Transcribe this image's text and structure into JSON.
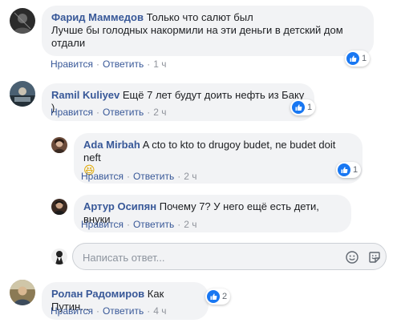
{
  "comments": [
    {
      "author": "Фарид Маммедов",
      "text_line1": "Только что салют был",
      "text_line2": "Лучше бы голодных накормили на эти деньги в детский дом",
      "text_line3": "отдали",
      "like_label": "Нравится",
      "reply_label": "Ответить",
      "time": "1 ч",
      "reaction_count": "1"
    },
    {
      "author": "Ramil Kuliyev",
      "text": "Ещё 7 лет будут доить нефть из Баку )",
      "like_label": "Нравится",
      "reply_label": "Ответить",
      "time": "2 ч",
      "reaction_count": "1",
      "replies": [
        {
          "author": "Ada Mirbah",
          "text": "A cto to kto to drugoy budet, ne budet doit neft",
          "emoji": "😆",
          "like_label": "Нравится",
          "reply_label": "Ответить",
          "time": "2 ч",
          "reaction_count": "1"
        },
        {
          "author": "Артур Осипян",
          "text": "Почему 7? У него ещё есть дети, внуки",
          "like_label": "Нравится",
          "reply_label": "Ответить",
          "time": "2 ч"
        }
      ]
    },
    {
      "author": "Ролан Радомиров",
      "text": "Как Путин...",
      "like_label": "Нравится",
      "reply_label": "Ответить",
      "time": "4 ч",
      "reaction_count": "2"
    }
  ],
  "reply_input": {
    "placeholder": "Написать ответ..."
  },
  "icons": {
    "like": "like-icon",
    "emoji": "smiley-icon",
    "sticker": "sticker-icon"
  },
  "colors": {
    "name": "#385898",
    "bubble": "#f2f3f5",
    "like_blue": "#1877f2",
    "meta": "#90949c"
  }
}
